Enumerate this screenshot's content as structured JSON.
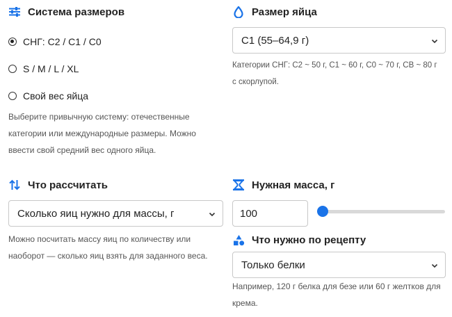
{
  "size_system": {
    "title": "Система размеров",
    "options": [
      {
        "label": "СНГ: С2 / С1 / С0",
        "checked": true
      },
      {
        "label": "S / M / L / XL",
        "checked": false
      },
      {
        "label": "Свой вес яйца",
        "checked": false
      }
    ],
    "hint_lines": [
      "Выберите привычную систему: отечественные",
      "категории или международные размеры. Можно",
      "ввести свой средний вес одного яйца."
    ]
  },
  "egg_size": {
    "title": "Размер яйца",
    "selected": "С1 (55–64,9 г)",
    "hint_lines": [
      "Категории СНГ: С2 ~ 50 г, С1 ~ 60 г, С0 ~ 70 г, СВ ~ 80 г",
      "с скорлупой."
    ]
  },
  "calculate": {
    "title": "Что рассчитать",
    "selected": "Сколько яиц нужно для массы, г",
    "hint_lines": [
      "Можно посчитать массу яиц по количеству или",
      "наоборот — сколько яиц взять для заданного веса."
    ]
  },
  "mass": {
    "title": "Нужная масса, г",
    "value": "100",
    "slider_fraction": 0
  },
  "recipe": {
    "title": "Что нужно по рецепту",
    "selected": "Только белки",
    "hint_lines": [
      "Например, 120 г белка для безе или 60 г желтков для",
      "крема."
    ]
  },
  "colors": {
    "accent": "#1a73e8"
  }
}
